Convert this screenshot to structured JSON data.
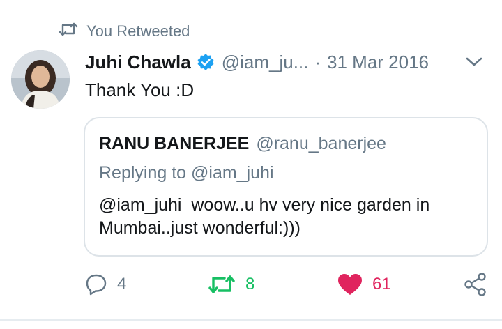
{
  "retweet_context": {
    "label": "You Retweeted",
    "icon": "retweet-icon"
  },
  "tweet": {
    "author_name": "Juhi Chawla",
    "verified": true,
    "handle": "@iam_ju...",
    "separator": "·",
    "date": "31 Mar 2016",
    "text": "Thank You :D",
    "avatar_icon": "avatar"
  },
  "quoted_tweet": {
    "author_name": "RANU BANERJEE",
    "handle": "@ranu_banerjee",
    "replying_to": "Replying to @iam_juhi",
    "text": "@iam_juhi  woow..u hv very nice garden in\nMumbai..just wonderful:)))"
  },
  "actions": {
    "reply_count": "4",
    "retweet_count": "8",
    "like_count": "61"
  },
  "colors": {
    "muted_text": "#657786",
    "retweet_green": "#17bf63",
    "like_red": "#e0245e",
    "verified_blue": "#1da1f2",
    "border": "#dde3e8"
  }
}
